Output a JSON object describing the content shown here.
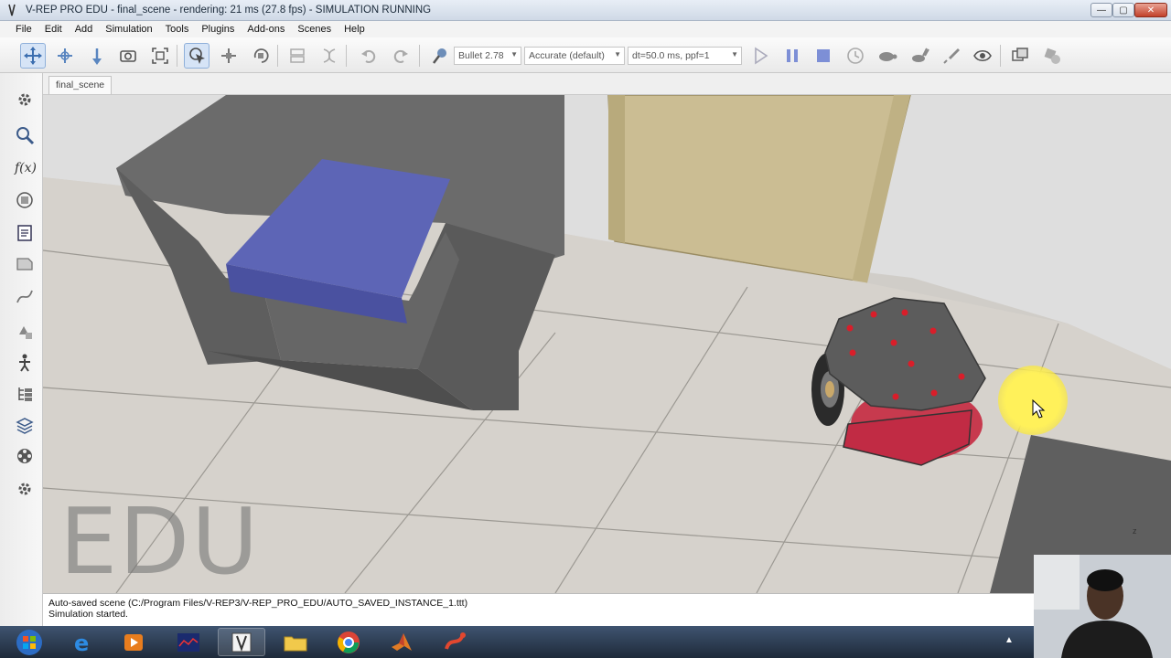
{
  "window": {
    "title": "V-REP PRO EDU - final_scene - rendering: 21 ms (27.8 fps) - SIMULATION RUNNING",
    "min_glyph": "—",
    "max_glyph": "▢",
    "close_glyph": "✕"
  },
  "menu": [
    "File",
    "Edit",
    "Add",
    "Simulation",
    "Tools",
    "Plugins",
    "Add-ons",
    "Scenes",
    "Help"
  ],
  "toolbar": {
    "engine": "Bullet 2.78",
    "accuracy": "Accurate (default)",
    "timestep": "dt=50.0 ms, ppf=1"
  },
  "tabs": {
    "scene": "final_scene"
  },
  "viewport": {
    "watermark": "EDU",
    "axis_label": "z"
  },
  "status": {
    "line1": "Auto-saved scene (C:/Program Files/V-REP3/V-REP_PRO_EDU/AUTO_SAVED_INSTANCE_1.ttt)",
    "line2": "Simulation started."
  },
  "taskbar": {
    "tray_arrow": "▲"
  }
}
